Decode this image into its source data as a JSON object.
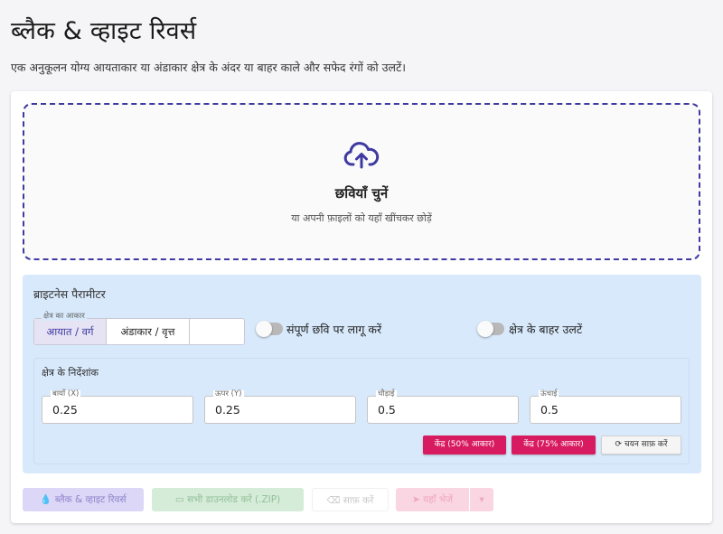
{
  "header": {
    "title": "ब्लैक & व्हाइट रिवर्स",
    "subtitle": "एक अनुकूलन योग्य आयताकार या अंडाकार क्षेत्र के अंदर या बाहर काले और सफेद रंगों को उलटें।"
  },
  "dropzone": {
    "icon": "cloud-upload-icon",
    "title": "छवियाँ चुनें",
    "hint": "या अपनी फ़ाइलों को यहाँ खींचकर छोड़ें"
  },
  "params": {
    "title": "ब्राइटनेस पैरामीटर",
    "shape": {
      "legend": "क्षेत्र का आकार",
      "options": [
        "आयात / वर्ग",
        "अंडाकार / वृत्त"
      ],
      "selected": "आयात / वर्ग"
    },
    "toggles": [
      {
        "label": "संपूर्ण छवि पर लागू करें",
        "on": false
      },
      {
        "label": "क्षेत्र के बाहर उलटें",
        "on": false
      }
    ],
    "coords": {
      "title": "क्षेत्र के निर्देशांक",
      "fields": [
        {
          "label": "बायाँ (X)",
          "value": "0.25"
        },
        {
          "label": "ऊपर (Y)",
          "value": "0.25"
        },
        {
          "label": "चौड़ाई",
          "value": "0.5"
        },
        {
          "label": "ऊंचाई",
          "value": "0.5"
        }
      ],
      "buttons": {
        "center50": "केंद्र (50% आकार)",
        "center75": "केंद्र (75% आकार)",
        "reset": "चयन साफ़ करें"
      }
    }
  },
  "actions": {
    "bw": "ब्लैक & व्हाइट रिवर्स",
    "zip": "सभी डाउनलोड करें (.ZIP)",
    "clear": "साफ़ करें",
    "send": "यहाँ भेजें"
  },
  "colors": {
    "accent": "#3f3aa0",
    "panel": "#d8e9fb",
    "pink": "#d81b60"
  }
}
